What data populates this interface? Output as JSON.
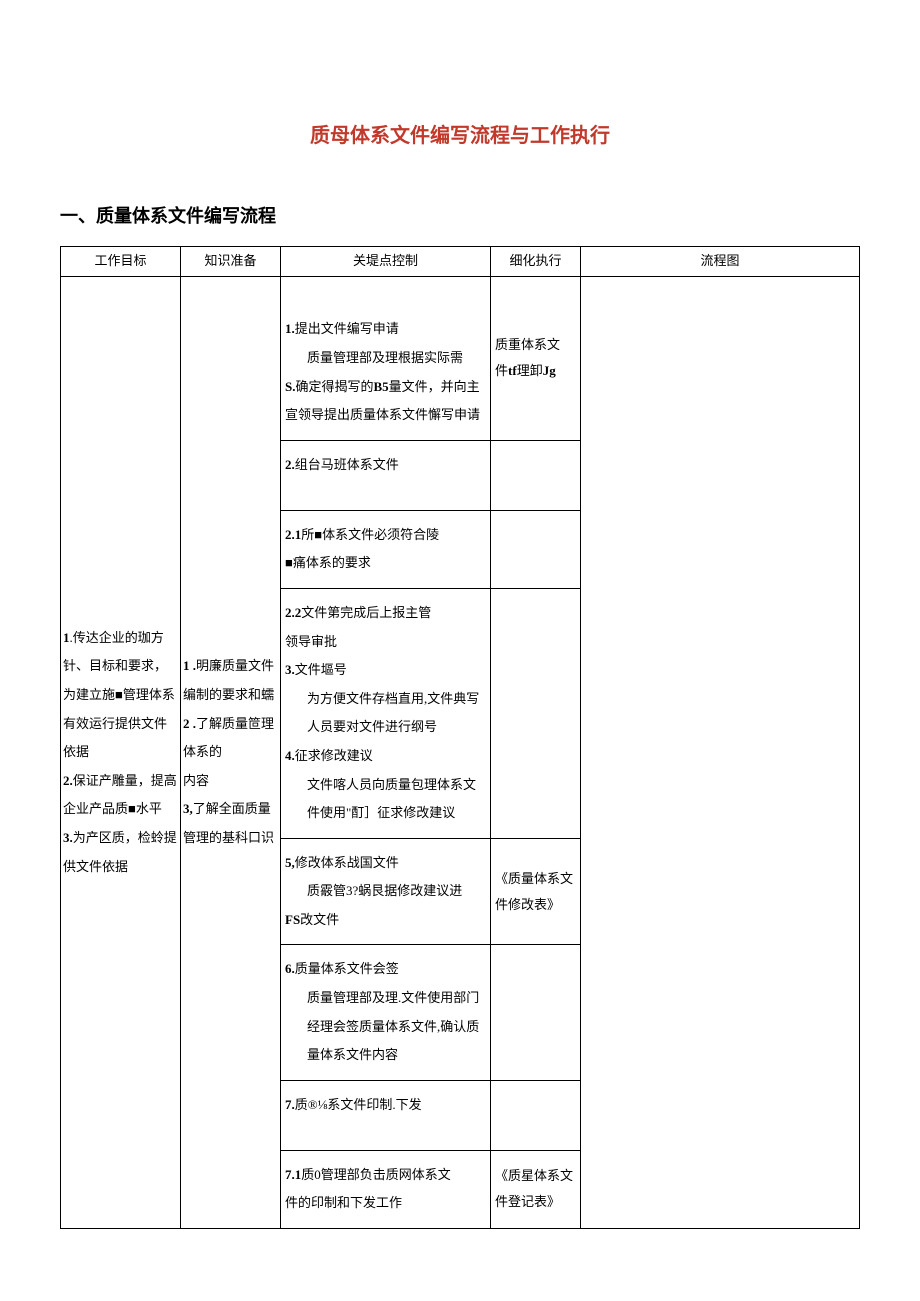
{
  "title": "质母体系文件编写流程与工作执行",
  "section_heading": "一、质量体系文件编写流程",
  "headers": {
    "goal": "工作目标",
    "knowledge": "知识准备",
    "keypoint": "关堤点控制",
    "detail": "细化执行",
    "flow": "流程图"
  },
  "goal": {
    "p1_lead": "1",
    "p1_text": ".传达企业的珈方针、目标和要求，为建立施■管理体系有效运行提供文件依据",
    "p2_lead": "2.",
    "p2_text": "保证产雕量，提高企业产品质■水平",
    "p3_lead": "3.",
    "p3_text": "为产区质，检蛉提供文件依据"
  },
  "knowledge": {
    "p1_lead": "1 .",
    "p1_text": "明廉质量文件编制的要求和蠕",
    "p2_lead": "2 .",
    "p2_text": "了解质量笸理体系的",
    "p2_text2": "内容",
    "p3_lead": "3,",
    "p3_text": "了解全面质量管理的基科口识"
  },
  "keypoints": {
    "k1_lead": "1.",
    "k1_title": "提出文件编写申请",
    "k1_body1": "质量管理部及理根据实际需",
    "k1_body2_lead": "S.",
    "k1_body2": "确定得揭写的",
    "k1_body2_b": "B5",
    "k1_body2_tail": "量文件，并向主宣领导提出质量体系文件懈写申请",
    "k2_lead": "2.",
    "k2_title": "组台马班体系文件",
    "k21_lead": "2.1",
    "k21_text": "所■体系文件必须符合陵",
    "k21_text2": "■痛体系的要求",
    "k22_lead": "2.2",
    "k22_text": "文件第完成后上报主管",
    "k22_text2": "领导审批",
    "k3_lead": "3.",
    "k3_title": "文件塸号",
    "k3_body": "为方便文件存档直用,文件典写人员要对文件进行纲号",
    "k4_lead": "4.",
    "k4_title": "征求修改建议",
    "k4_body": "文件喀人员向质量包理体系文件使用\"酊］征求修改建议",
    "k5_lead": "5,",
    "k5_title": "修改体系战国文件",
    "k5_body1": "质霰管3?蜗艮据修改建议进",
    "k5_body2_lead": "FS",
    "k5_body2": "改文件",
    "k6_lead": "6.",
    "k6_title": "质量体系文件会签",
    "k6_body": "质量管理部及理.文件使用部门经理会签质量体系文件,确认质量体系文件内容",
    "k7_lead": "7.",
    "k7_title": "质®⅛系文件印制.下发",
    "k71_lead": "7.1",
    "k71_text": "质0管理部负击质网体系文",
    "k71_text2": "件的印制和下发工作"
  },
  "details": {
    "d1a": "质重体系文",
    "d1b": "件",
    "d1b_bold": "tf",
    "d1b_tail": "理卸",
    "d1b_bold2": "Jg",
    "d5": "《质量体系文件修改表》",
    "d71": "《质星体系文件登记表》"
  }
}
